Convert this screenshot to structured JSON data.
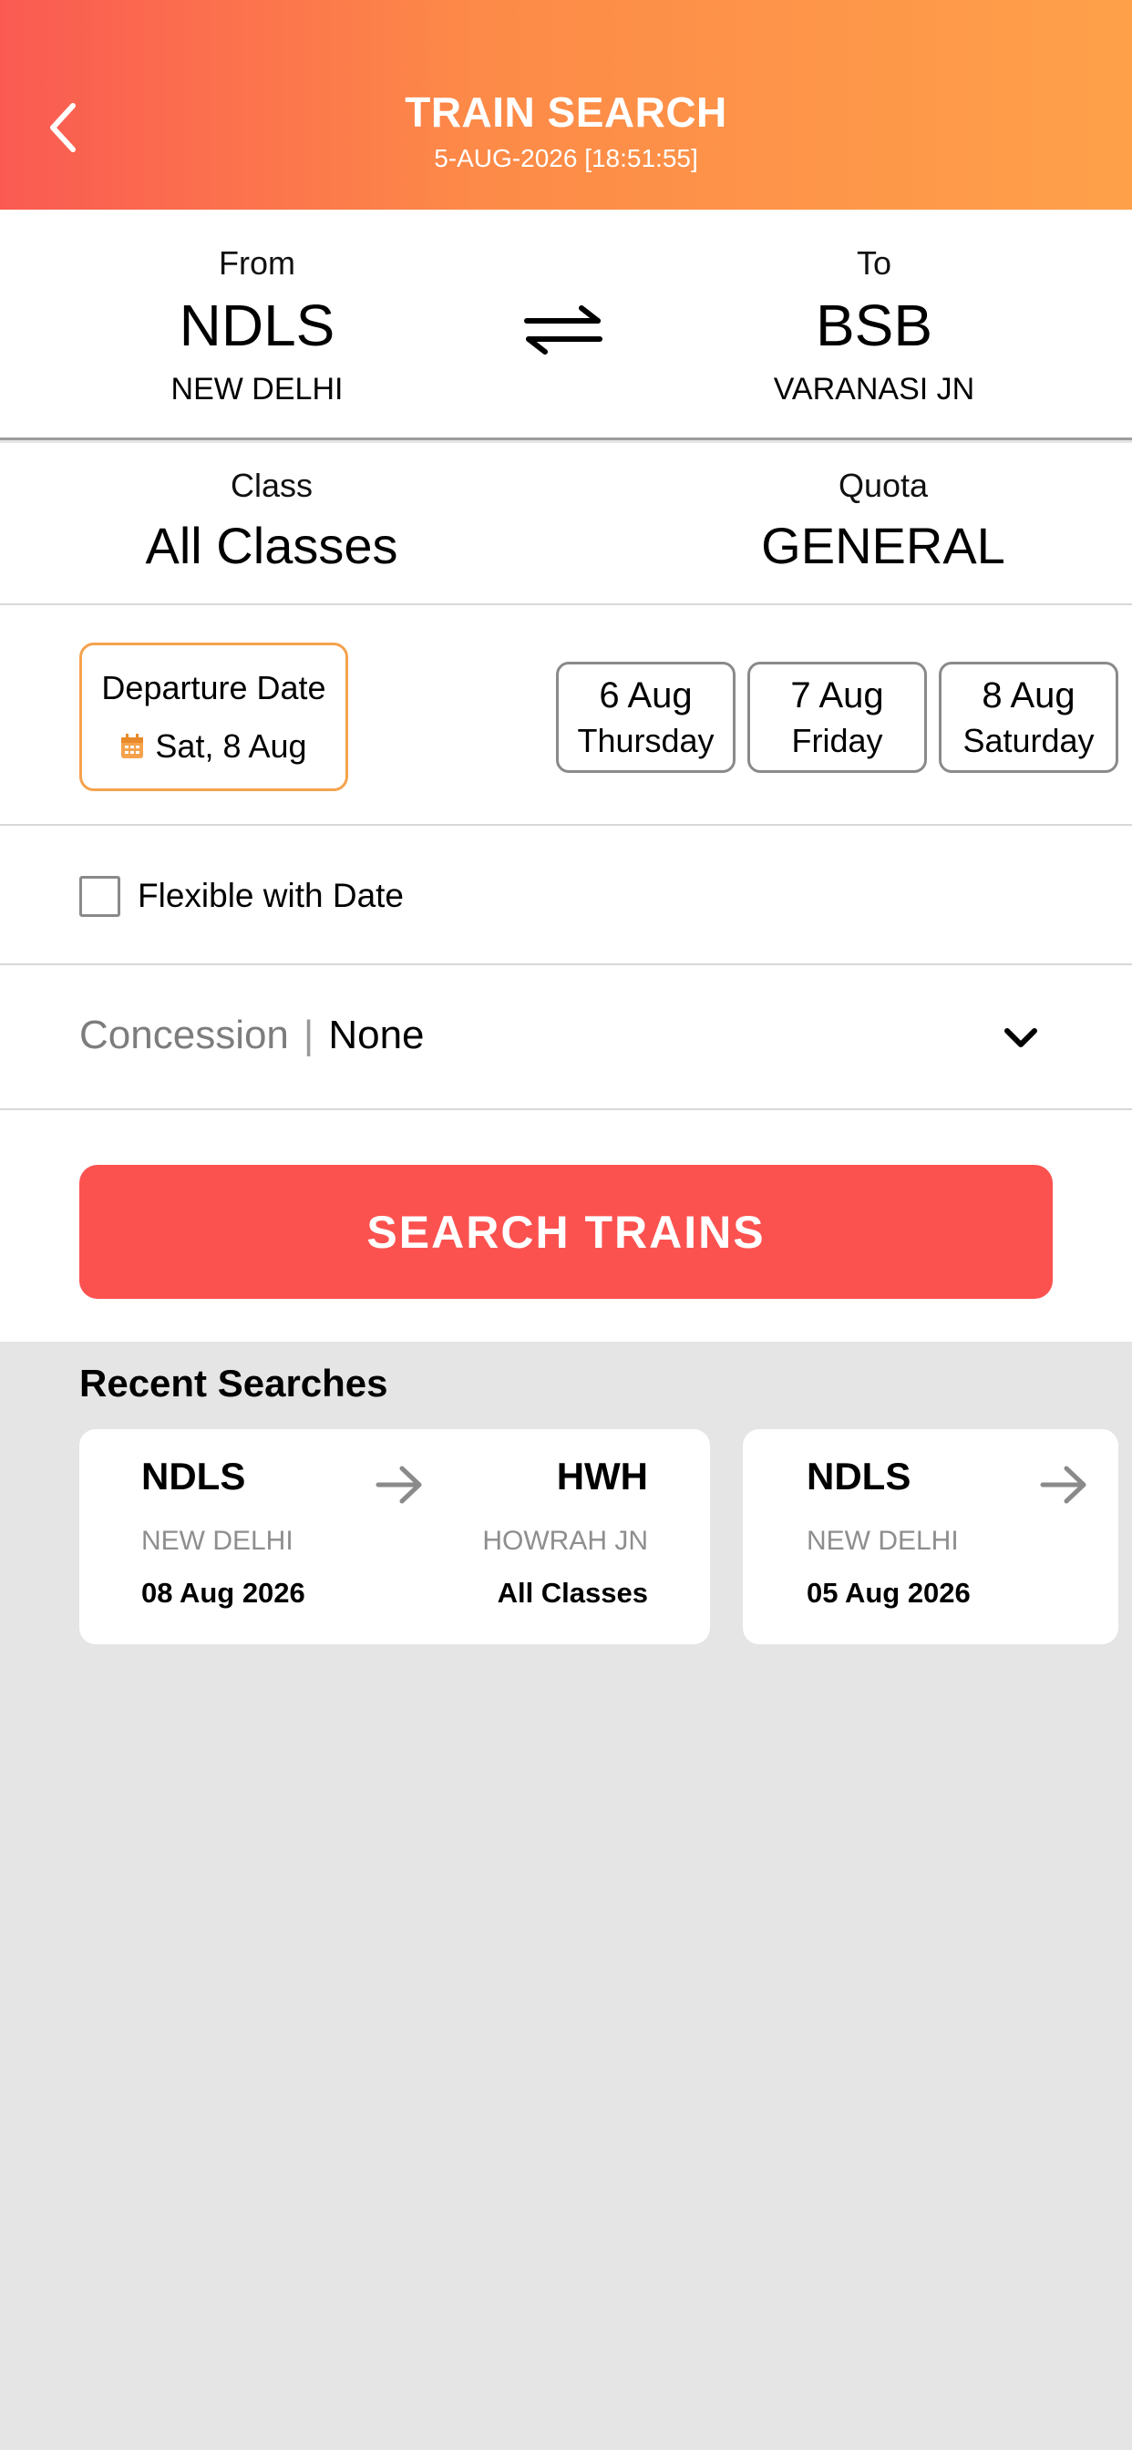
{
  "header": {
    "title": "TRAIN SEARCH",
    "subtitle": "5-AUG-2026 [18:51:55]",
    "back_icon": "chevron-left-icon"
  },
  "route": {
    "from": {
      "label": "From",
      "code": "NDLS",
      "name": "NEW DELHI"
    },
    "to": {
      "label": "To",
      "code": "BSB",
      "name": "VARANASI JN"
    },
    "swap_icon": "swap-arrows-icon"
  },
  "class": {
    "label": "Class",
    "value": "All Classes"
  },
  "quota": {
    "label": "Quota",
    "value": "GENERAL"
  },
  "departure": {
    "label": "Departure Date",
    "value": "Sat, 8 Aug",
    "icon": "calendar-icon",
    "chips": [
      {
        "date": "6 Aug",
        "day": "Thursday"
      },
      {
        "date": "7 Aug",
        "day": "Friday"
      },
      {
        "date": "8 Aug",
        "day": "Saturday"
      }
    ]
  },
  "flexible": {
    "label": "Flexible with Date",
    "checked": false
  },
  "concession": {
    "label": "Concession",
    "separator": "|",
    "value": "None"
  },
  "search_button": {
    "label": "SEARCH TRAINS"
  },
  "recent": {
    "title": "Recent Searches",
    "items": [
      {
        "from_code": "NDLS",
        "from_name": "NEW DELHI",
        "date": "08 Aug 2026",
        "to_code": "HWH",
        "to_name": "HOWRAH JN",
        "class": "All Classes"
      },
      {
        "from_code": "NDLS",
        "from_name": "NEW DELHI",
        "date": "05 Aug 2026"
      }
    ]
  },
  "colors": {
    "header_gradient_start": "#fa5a52",
    "header_gradient_end": "#fea04a",
    "primary_button": "#fb5250",
    "accent_orange": "#f5a24d",
    "background_gray": "#e5e5e5"
  }
}
